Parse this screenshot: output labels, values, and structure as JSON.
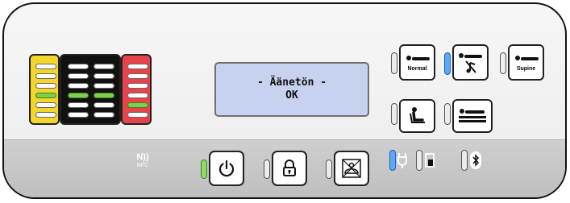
{
  "lcd": {
    "line1": "- Äänetön -",
    "line2": "OK"
  },
  "modes": {
    "normal_label": "Normal",
    "supine_label": "Supine"
  },
  "nfc": {
    "label": "NFC"
  },
  "colors": {
    "yellow": "#f3d52b",
    "black": "#111111",
    "red": "#e8434b",
    "led_on": "#7fcf4a",
    "indicator_blue": "#5aa9ff",
    "lcd_bg": "#c7d2ee"
  },
  "icons": [
    "nfc-icon",
    "power-icon",
    "lock-icon",
    "no-pressure-icon",
    "mains-plug-icon",
    "battery-icon",
    "bluetooth-icon",
    "patient-lying-icon",
    "patient-lying-mute-icon",
    "patient-sitting-icon",
    "mattress-icon"
  ]
}
